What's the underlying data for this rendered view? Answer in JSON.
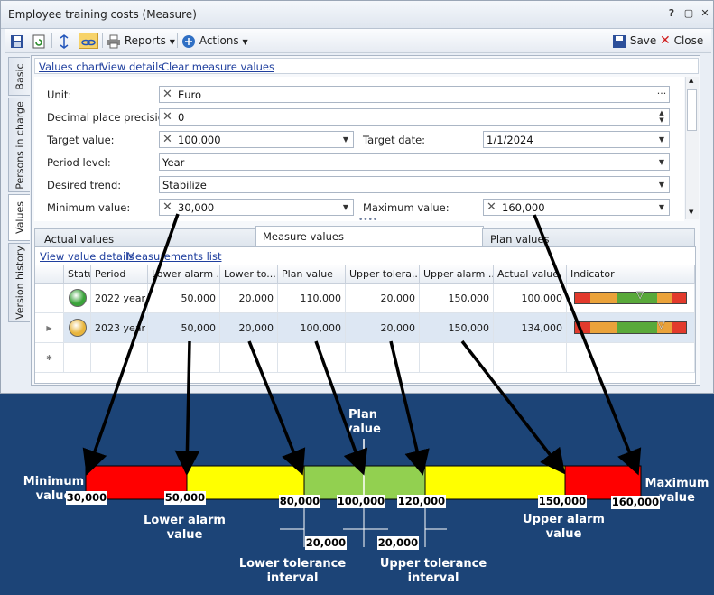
{
  "window": {
    "title": "Employee training costs (Measure)",
    "help_label": "?"
  },
  "toolbar": {
    "reports_label": "Reports",
    "actions_label": "Actions",
    "save_label": "Save",
    "close_label": "Close"
  },
  "vtabs": [
    "Basic",
    "Persons in charge",
    "Values",
    "Version history"
  ],
  "links": {
    "values_chart": "Values chart",
    "view_details": "View details",
    "clear_values": "Clear measure values"
  },
  "form": {
    "unit_label": "Unit:",
    "unit_value": "Euro",
    "decimal_label": "Decimal place precision:",
    "decimal_value": "0",
    "target_label": "Target value:",
    "target_value": "100,000",
    "target_date_label": "Target date:",
    "target_date_value": "1/1/2024",
    "period_label": "Period level:",
    "period_value": "Year",
    "trend_label": "Desired trend:",
    "trend_value": "Stabilize",
    "min_label": "Minimum value:",
    "min_value": "30,000",
    "max_label": "Maximum value:",
    "max_value": "160,000"
  },
  "tabs2": [
    "Actual values",
    "Measure values",
    "Plan values"
  ],
  "gridlinks": {
    "details": "View value details",
    "list": "Measurements list"
  },
  "grid": {
    "headers": [
      "Status",
      "Period",
      "Lower alarm ...",
      "Lower to...",
      "Plan value",
      "Upper tolera...",
      "Upper alarm ...",
      "Actual value",
      "Indicator"
    ],
    "rows": [
      {
        "status_color": "#3aa33a",
        "period": "2022 year",
        "lower_alarm": "50,000",
        "lower_tol": "20,000",
        "plan": "110,000",
        "upper_tol": "20,000",
        "upper_alarm": "150,000",
        "actual": "100,000",
        "indicator_pos": 0.58
      },
      {
        "status_color": "#e8b53c",
        "period": "2023 year",
        "lower_alarm": "50,000",
        "lower_tol": "20,000",
        "plan": "100,000",
        "upper_tol": "20,000",
        "upper_alarm": "150,000",
        "actual": "134,000",
        "indicator_pos": 0.78
      }
    ]
  },
  "diagram": {
    "plan_label": "Plan value",
    "min_label": "Minimum value",
    "max_label": "Maximum value",
    "lower_alarm_label": "Lower alarm value",
    "upper_alarm_label": "Upper alarm value",
    "lower_tol_label": "Lower tolerance interval",
    "upper_tol_label": "Upper tolerance interval",
    "values": [
      "30,000",
      "50,000",
      "80,000",
      "100,000",
      "120,000",
      "150,000",
      "160,000"
    ],
    "interval_values": [
      "20,000",
      "20,000"
    ],
    "colors": {
      "red": "#ff0000",
      "yellow": "#ffff00",
      "green": "#92d050",
      "background": "#1c4477"
    }
  }
}
